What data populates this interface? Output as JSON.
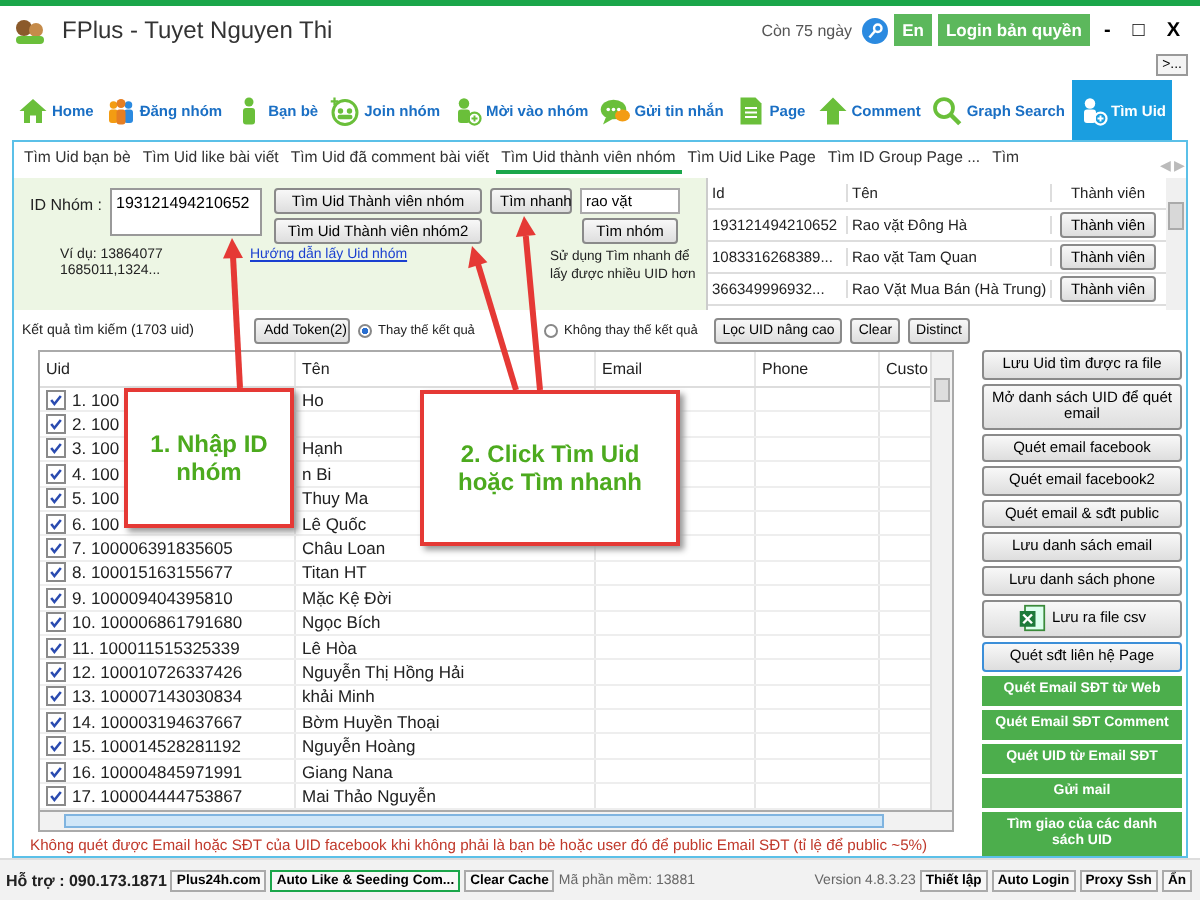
{
  "window": {
    "title": "FPlus - Tuyet Nguyen Thi",
    "days_left": "Còn 75 ngày",
    "language_button": "En",
    "license_button": "Login bản quyền",
    "controls": [
      "-",
      "□",
      "X"
    ],
    "overflow_button": ">..."
  },
  "toolbar": [
    {
      "label": "Home",
      "kind": "home",
      "selected": false
    },
    {
      "label": "Đăng nhóm",
      "kind": "group",
      "selected": false
    },
    {
      "label": "Bạn bè",
      "kind": "person",
      "selected": false
    },
    {
      "label": "Join nhóm",
      "kind": "join",
      "selected": false
    },
    {
      "label": "Mời vào nhóm",
      "kind": "person-plus",
      "selected": false
    },
    {
      "label": "Gửi tin nhắn",
      "kind": "chat",
      "selected": false
    },
    {
      "label": "Page",
      "kind": "page",
      "selected": false
    },
    {
      "label": "Comment",
      "kind": "up",
      "selected": false
    },
    {
      "label": "Graph Search",
      "kind": "search",
      "selected": false
    },
    {
      "label": "Tìm Uid",
      "kind": "person-plus",
      "selected": true
    }
  ],
  "subtabs": [
    {
      "label": "Tìm Uid bạn bè",
      "selected": false
    },
    {
      "label": "Tìm Uid like bài viết",
      "selected": false
    },
    {
      "label": "Tìm Uid đã comment bài viết",
      "selected": false
    },
    {
      "label": "Tìm Uid thành viên nhóm",
      "selected": true
    },
    {
      "label": "Tìm Uid Like Page",
      "selected": false
    },
    {
      "label": "Tìm ID Group Page ...",
      "selected": false
    },
    {
      "label": "Tìm",
      "selected": false
    }
  ],
  "tab_scroll": [
    "◀",
    "▶"
  ],
  "form": {
    "id_label": "ID Nhóm :",
    "id_value": "193121494210652",
    "buttons": [
      "Tìm Uid Thành viên nhóm",
      "Tìm Uid Thành viên nhóm2",
      "Tìm nhanh",
      "Tìm nhóm"
    ],
    "search_value": "rao vặt",
    "example": [
      "Ví dụ: 13864077",
      "1685011,1324..."
    ],
    "guide_link": "Hướng dẫn lấy Uid nhóm",
    "tip": "Sử dụng Tìm nhanh để lấy được nhiều UID hơn"
  },
  "group_grid": {
    "columns": [
      "Id",
      "Tên",
      "Thành viên"
    ],
    "rows": [
      {
        "id": "193121494210652",
        "name": "Rao vặt Đông Hà",
        "action": "Thành viên"
      },
      {
        "id": "1083316268389...",
        "name": "Rao vặt Tam Quan",
        "action": "Thành viên"
      },
      {
        "id": "366349996932...",
        "name": "Rao Vặt Mua Bán (Hà Trung)",
        "action": "Thành viên"
      }
    ]
  },
  "results": {
    "summary": "Kết quả tìm kiếm (1703 uid)",
    "add_token": "Add Token(2)",
    "options": [
      {
        "label": "Thay thế kết quả",
        "selected": true
      },
      {
        "label": "Không thay thế kết quả",
        "selected": false
      }
    ],
    "buttons": [
      "Lọc UID nâng cao",
      "Clear",
      "Distinct"
    ],
    "columns": [
      "Uid",
      "Tên",
      "Email",
      "Phone",
      "Custo"
    ],
    "rows": [
      {
        "uid": "1. 100",
        "name": "Ho",
        "checked": true
      },
      {
        "uid": "2. 100",
        "checked": true
      },
      {
        "uid": "3. 100",
        "name": "Hạnh",
        "checked": true
      },
      {
        "uid": "4. 100",
        "name": "n Bi",
        "checked": true
      },
      {
        "uid": "5. 100",
        "name": "Thuy Ma",
        "checked": true
      },
      {
        "uid": "6. 100",
        "name": "Lê Quốc",
        "checked": true
      },
      {
        "uid": "7. 100006391835605",
        "name": "Châu Loan",
        "checked": true
      },
      {
        "uid": "8. 100015163155677",
        "name": "Titan HT",
        "checked": true
      },
      {
        "uid": "9. 100009404395810",
        "name": "Mặc Kệ Đời",
        "checked": true
      },
      {
        "uid": "10. 100006861791680",
        "name": "Ngọc Bích",
        "checked": true
      },
      {
        "uid": "11. 100011515325339",
        "name": "Lê Hòa",
        "checked": true
      },
      {
        "uid": "12. 100010726337426",
        "name": "Nguyễn Thị Hồng Hải",
        "checked": true
      },
      {
        "uid": "13. 100007143030834",
        "name": "khải Minh",
        "checked": true
      },
      {
        "uid": "14. 100003194637667",
        "name": "Bờm Huyền Thoại",
        "checked": true
      },
      {
        "uid": "15. 100014528281192",
        "name": "Nguyễn Hoàng",
        "checked": true
      },
      {
        "uid": "16. 100004845971991",
        "name": "Giang Nana",
        "checked": true
      },
      {
        "uid": "17. 100004444753867",
        "name": "Mai Thảo Nguyễn",
        "checked": true
      }
    ]
  },
  "note": "Không quét được Email hoặc SĐT của UID facebook khi không phải là bạn bè hoặc user đó để public Email SĐT (tỉ lệ để public ~5%)",
  "actions": [
    {
      "label": "Lưu Uid tìm được ra file",
      "kind": "plain"
    },
    {
      "label": "Mở danh sách UID để quét email",
      "kind": "plain"
    },
    {
      "label": "Quét email facebook",
      "kind": "plain"
    },
    {
      "label": "Quét email facebook2",
      "kind": "plain"
    },
    {
      "label": "Quét email & sđt public",
      "kind": "plain"
    },
    {
      "label": "Lưu danh sách email",
      "kind": "plain"
    },
    {
      "label": "Lưu danh sách phone",
      "kind": "plain"
    },
    {
      "label": "Lưu ra file csv",
      "kind": "excel"
    },
    {
      "label": "Quét sđt liên hệ Page",
      "kind": "focused"
    },
    {
      "label": "Quét Email SĐT từ Web",
      "kind": "green"
    },
    {
      "label": "Quét Email SĐT Comment",
      "kind": "green"
    },
    {
      "label": "Quét UID từ Email SĐT",
      "kind": "green"
    },
    {
      "label": "Gửi mail",
      "kind": "green"
    },
    {
      "label": "Tìm giao của các danh sách UID",
      "kind": "green"
    }
  ],
  "callouts": [
    "1. Nhập ID nhóm",
    "2. Click Tìm Uid hoặc Tìm nhanh"
  ],
  "status_bar": {
    "support": "Hỗ trợ : 090.173.1871",
    "buttons": [
      {
        "label": "Plus24h.com",
        "kind": "plain"
      },
      {
        "label": "Auto Like & Seeding Com...",
        "kind": "highlighted"
      },
      {
        "label": "Clear Cache",
        "kind": "plain"
      }
    ],
    "software_code": "Mã phần mềm: 13881",
    "version": "Version 4.8.3.23",
    "right_buttons": [
      "Thiết lập",
      "Auto Login",
      "Proxy Ssh",
      "Ẩn"
    ]
  }
}
